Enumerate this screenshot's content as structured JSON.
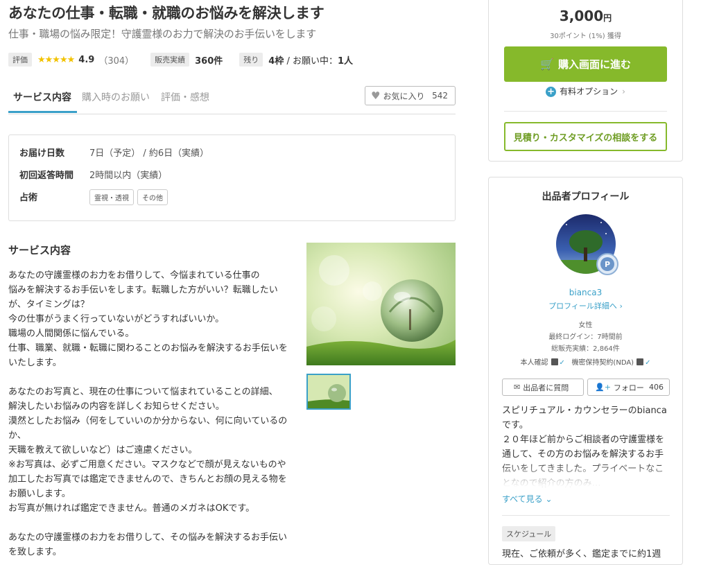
{
  "service": {
    "title": "あなたの仕事・転職・就職のお悩みを解決します",
    "subtitle": "仕事・職場の悩み限定！守護霊様のお力で解決のお手伝いをします"
  },
  "meta": {
    "rating_label": "評価",
    "stars": "★★★★★",
    "rating_value": "4.9",
    "rating_count": "（304）",
    "sales_label": "販売実績",
    "sales_value": "360件",
    "remaining_label": "残り",
    "remaining_slots": "4枠",
    "remaining_separator": " / お願い中：",
    "in_progress": "1人"
  },
  "tabs": {
    "items": [
      "サービス内容",
      "購入時のお願い",
      "評価・感想"
    ],
    "favorite_label": "お気に入り",
    "favorite_count": "542"
  },
  "info": {
    "delivery_label": "お届け日数",
    "delivery_value": "7日（予定） / 約6日（実績）",
    "response_label": "初回返答時間",
    "response_value": "2時間以内（実績）",
    "category_label": "占術",
    "tags": [
      "霊視・透視",
      "その他"
    ]
  },
  "description": {
    "heading": "サービス内容",
    "body": "あなたの守護霊様のお力をお借りして、今悩まれている仕事の\n悩みを解決するお手伝いをします。転職した方がいい？転職したい\nが、タイミングは？\n今の仕事がうまく行っていないがどうすればいいか。\n職場の人間関係に悩んでいる。\n仕事、職業、就職・転職に関わることのお悩みを解決するお手伝いを\nいたします。\n\nあなたのお写真と、現在の仕事について悩まれていることの詳細、\n解決したいお悩みの内容を詳しくお知らせください。\n漠然としたお悩み（何をしていいのか分からない、何に向いているの\nか、\n天職を教えて欲しいなど）はご遠慮ください。\n※お写真は、必ずご用意ください。マスクなどで顔が見えないものや\n加工したお写真では鑑定できませんので、きちんとお顔の見える物を\nお願いします。\nお写真が無ければ鑑定できません。普通のメガネはOKです。\n\nあなたの守護霊様のお力をお借りして、その悩みを解決するお手伝い\nを致します。"
  },
  "purchase": {
    "price": "3,000",
    "currency": "円",
    "points": "30ポイント (1%) 獲得",
    "buy_label": "購入画面に進む",
    "option_label": "有料オプション",
    "consult_label": "見積り・カスタマイズの相談をする"
  },
  "profile": {
    "heading": "出品者プロフィール",
    "username": "bianca3",
    "details_link": "プロフィール詳細へ",
    "gender": "女性",
    "last_login": "最終ログイン：7時間前",
    "total_sales": "総販売実績：2,864件",
    "identity_label": "本人確認",
    "nda_label": "機密保持契約(NDA)",
    "ask_label": "出品者に質問",
    "follow_label": "フォロー",
    "follow_count": "406",
    "bio": "スピリチュアル・カウンセラーのbianca\nです。\n２０年ほど前からご相談者の守護霊様を\n通して、その方のお悩みを解決するお手\n伝いをしてきました。プライベートなこ\nとなので紹介の方のみ…",
    "see_all": "すべて見る",
    "schedule_label": "スケジュール",
    "schedule_text": "現在、ご依頼が多く、鑑定までに約1週"
  },
  "colors": {
    "accent": "#3aa0c8",
    "buy_green": "#86b92b",
    "star": "#f2c200"
  }
}
